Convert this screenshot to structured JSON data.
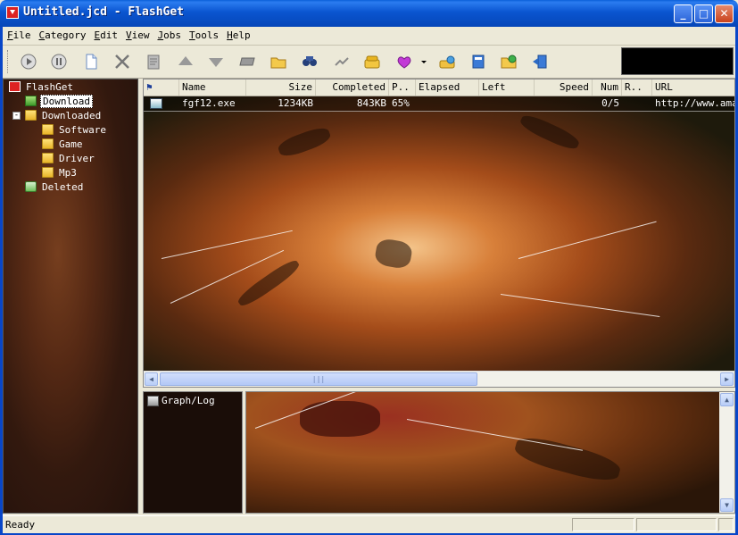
{
  "window": {
    "title": "Untitled.jcd - FlashGet"
  },
  "menu": [
    "File",
    "Category",
    "Edit",
    "View",
    "Jobs",
    "Tools",
    "Help"
  ],
  "toolbar": [
    {
      "name": "start-icon"
    },
    {
      "name": "pause-icon"
    },
    {
      "name": "new-icon"
    },
    {
      "name": "delete-icon"
    },
    {
      "name": "properties-icon"
    },
    {
      "name": "move-up-icon"
    },
    {
      "name": "move-down-icon"
    },
    {
      "name": "category-icon"
    },
    {
      "name": "open-folder-icon"
    },
    {
      "name": "find-icon"
    },
    {
      "name": "connect-icon"
    },
    {
      "name": "dial-icon"
    },
    {
      "name": "schedule-icon"
    },
    {
      "name": "options-icon"
    },
    {
      "name": "site-manager-icon"
    },
    {
      "name": "web-icon"
    },
    {
      "name": "exit-icon"
    }
  ],
  "tree": {
    "root": "FlashGet",
    "download": "Download",
    "downloaded": "Downloaded",
    "software": "Software",
    "game": "Game",
    "driver": "Driver",
    "mp3": "Mp3",
    "deleted": "Deleted"
  },
  "list": {
    "columns": [
      "Name",
      "Size",
      "Completed",
      "P..",
      "Elapsed",
      "Left",
      "Speed",
      "Num",
      "R..",
      "URL"
    ],
    "rows": [
      {
        "name": "fgf12.exe",
        "size": "1234KB",
        "completed": "843KB",
        "percent": "65%",
        "elapsed": "",
        "left": "",
        "speed": "",
        "num": "0/5",
        "r": "",
        "url": "http://www.amaz"
      }
    ]
  },
  "graph": {
    "label": "Graph/Log"
  },
  "status": {
    "text": "Ready"
  }
}
